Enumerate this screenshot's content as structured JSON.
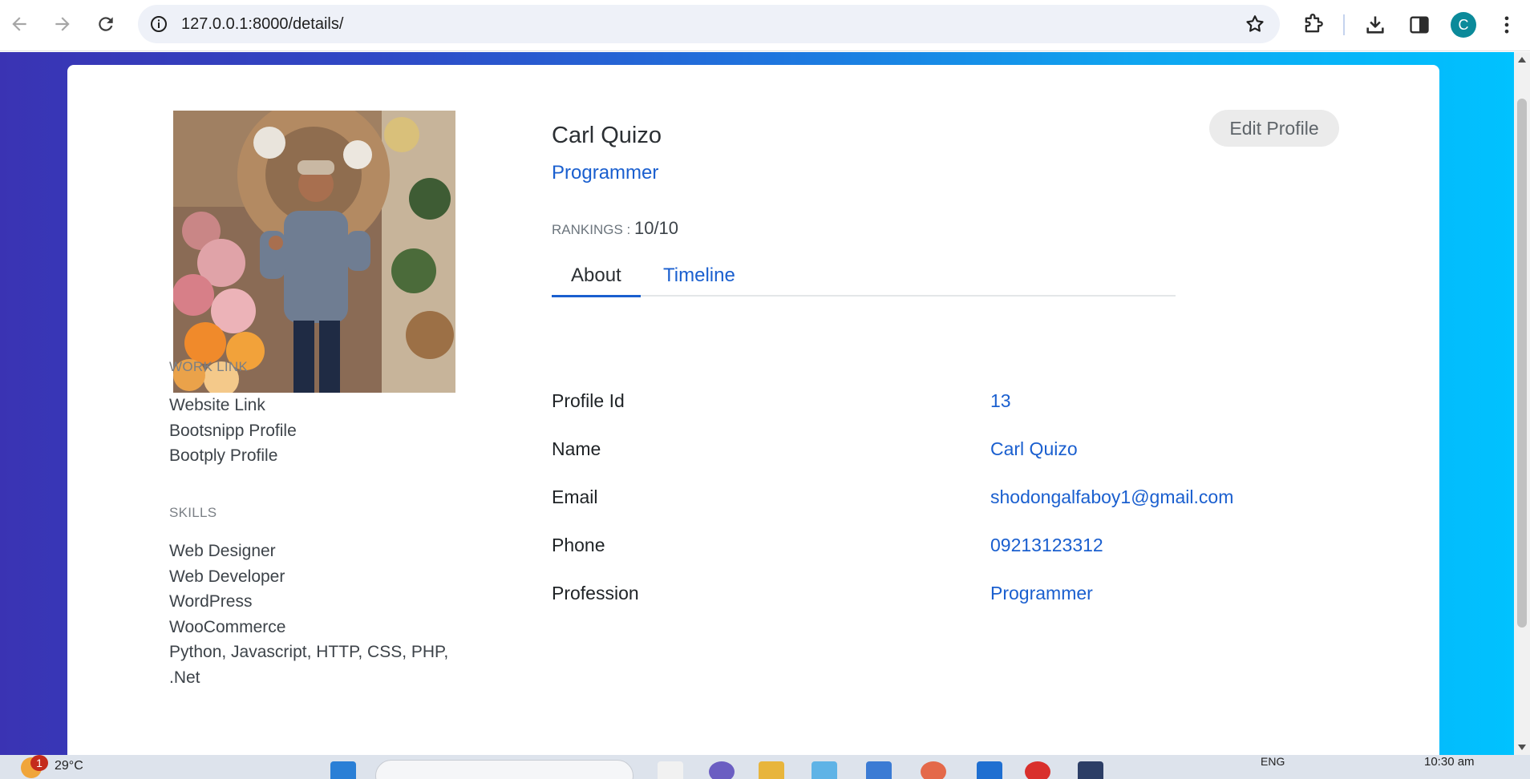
{
  "browser": {
    "url": "127.0.0.1:8000/details/",
    "profile_initial": "C"
  },
  "profile": {
    "name": "Carl Quizo",
    "role": "Programmer",
    "rankings_label": "RANKINGS : ",
    "rankings_value": "10/10",
    "edit_label": "Edit Profile"
  },
  "sidebar": {
    "work_link_title": "WORK LINK",
    "work_links": [
      "Website Link",
      "Bootsnipp Profile",
      "Bootply Profile"
    ],
    "skills_title": "SKILLS",
    "skills": [
      "Web Designer",
      "Web Developer",
      "WordPress",
      "WooCommerce",
      "Python, Javascript, HTTP, CSS, PHP,",
      ".Net"
    ]
  },
  "tabs": [
    "About",
    "Timeline"
  ],
  "about": [
    {
      "label": "Profile Id",
      "value": "13"
    },
    {
      "label": "Name",
      "value": "Carl Quizo"
    },
    {
      "label": "Email",
      "value": "shodongalfaboy1@gmail.com"
    },
    {
      "label": "Phone",
      "value": "09213123312"
    },
    {
      "label": "Profession",
      "value": "Programmer"
    }
  ],
  "taskbar": {
    "badge": "1",
    "temperature": "29°C",
    "language": "ENG",
    "time": "10:30 am"
  },
  "colors": {
    "accent": "#1a5fcf",
    "gradient_start": "#3a33b3",
    "gradient_end": "#00c2ff"
  }
}
